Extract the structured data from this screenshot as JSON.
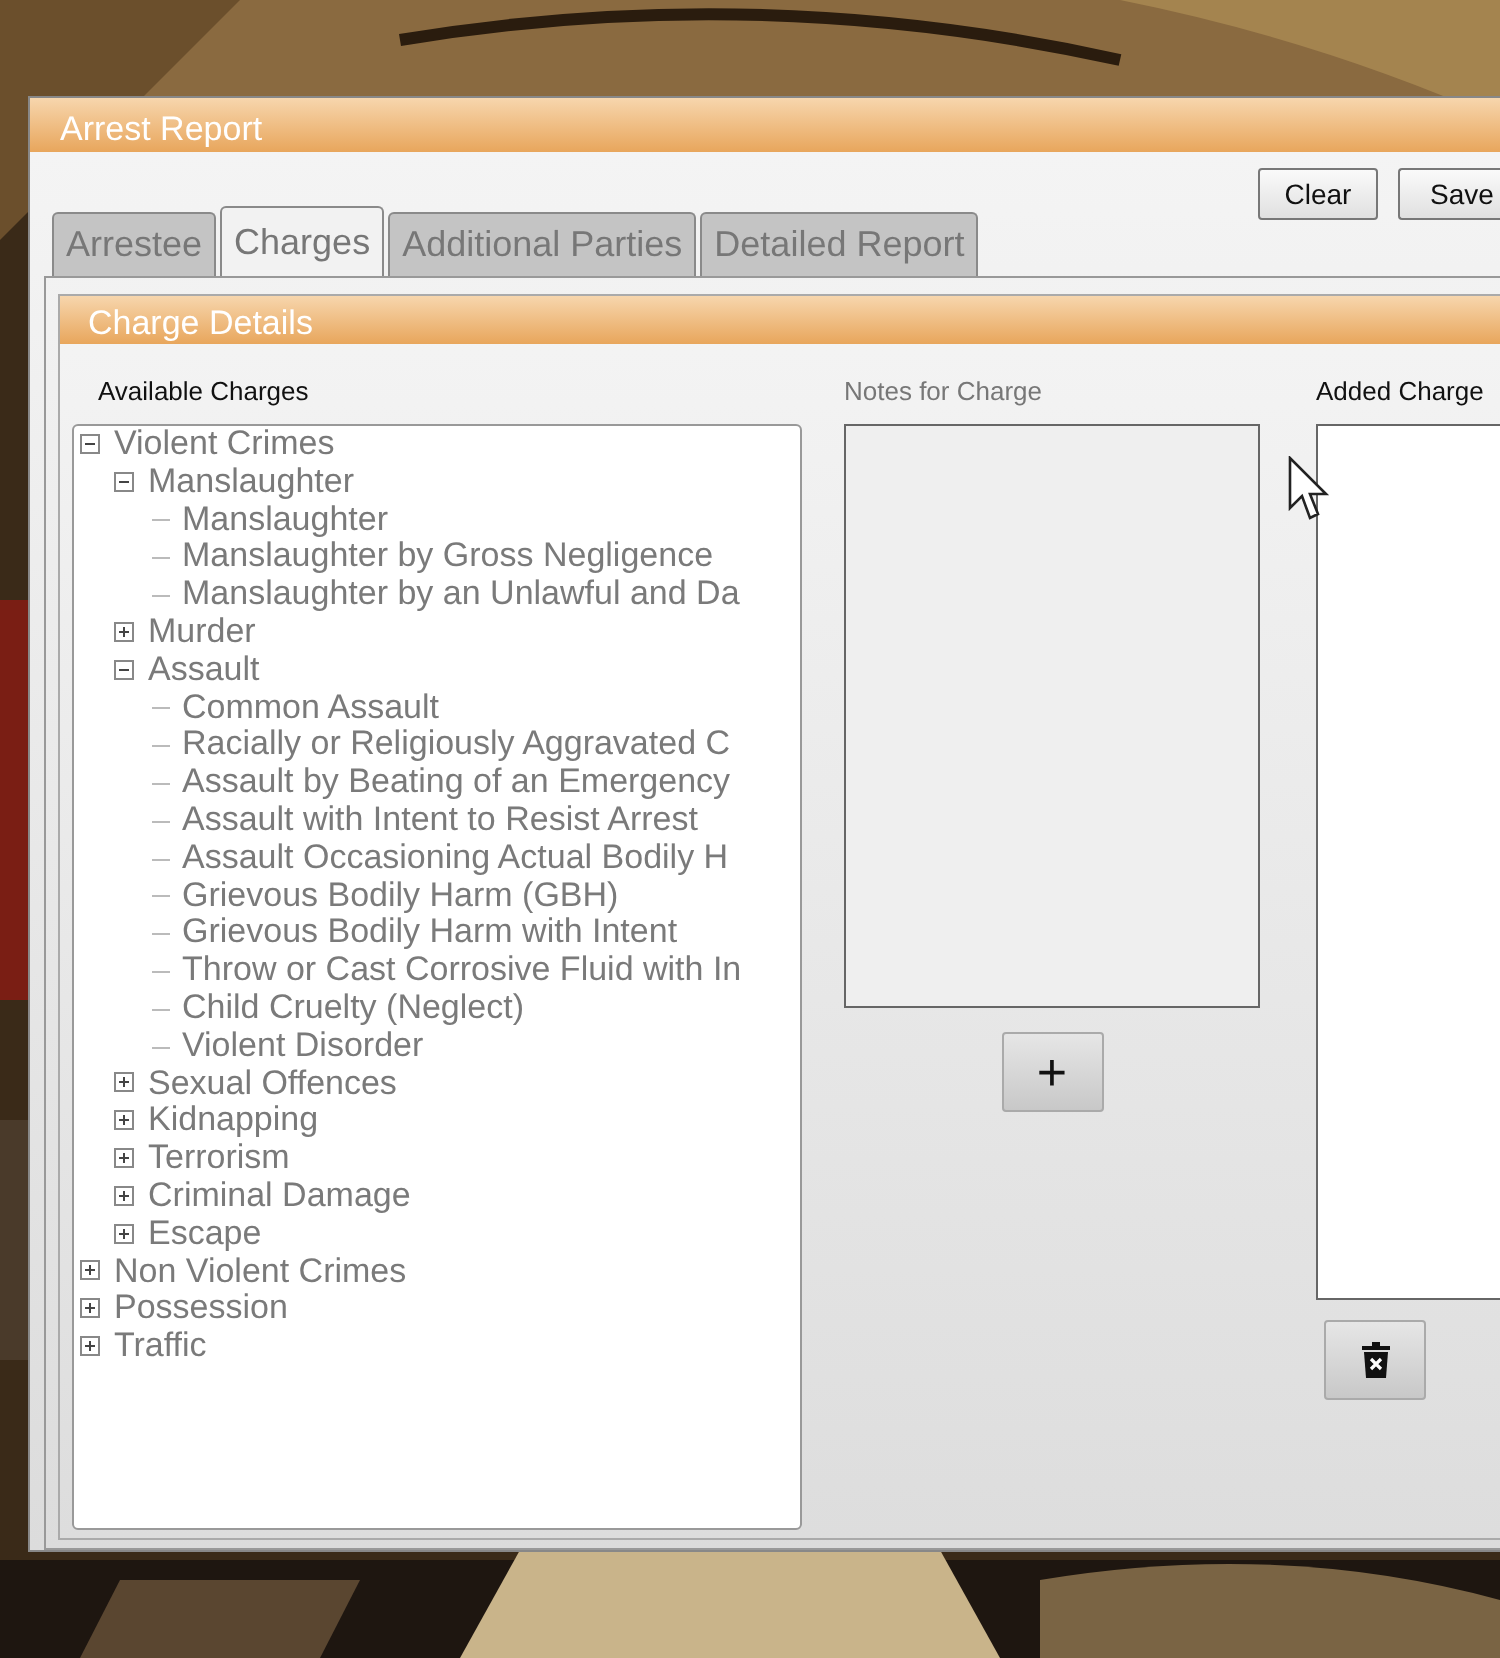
{
  "window": {
    "title": "Arrest Report"
  },
  "buttons": [
    {
      "label": "Clear"
    },
    {
      "label": "Save"
    }
  ],
  "tabs": [
    {
      "label": "Arrestee",
      "selected": false
    },
    {
      "label": "Charges",
      "selected": true
    },
    {
      "label": "Additional Parties",
      "selected": false
    },
    {
      "label": "Detailed Report",
      "selected": false
    }
  ],
  "group": {
    "title": "Charge Details"
  },
  "available_charges": {
    "label": "Available Charges",
    "tree": [
      {
        "label": "Violent Crimes",
        "expanded": true,
        "children": [
          {
            "label": "Manslaughter",
            "expanded": true,
            "children": [
              {
                "label": "Manslaughter"
              },
              {
                "label": "Manslaughter by Gross Negligence"
              },
              {
                "label": "Manslaughter by an Unlawful and Da"
              }
            ]
          },
          {
            "label": "Murder",
            "expanded": false
          },
          {
            "label": "Assault",
            "expanded": true,
            "children": [
              {
                "label": "Common Assault"
              },
              {
                "label": "Racially or Religiously Aggravated C"
              },
              {
                "label": "Assault by Beating of an Emergency"
              },
              {
                "label": "Assault with Intent to Resist Arrest"
              },
              {
                "label": "Assault Occasioning Actual Bodily H"
              },
              {
                "label": "Grievous Bodily Harm (GBH)"
              },
              {
                "label": "Grievous Bodily Harm with Intent"
              },
              {
                "label": "Throw or Cast Corrosive Fluid with In"
              },
              {
                "label": "Child Cruelty (Neglect)"
              },
              {
                "label": "Violent Disorder"
              }
            ]
          },
          {
            "label": "Sexual Offences",
            "expanded": false
          },
          {
            "label": "Kidnapping",
            "expanded": false
          },
          {
            "label": "Terrorism",
            "expanded": false
          },
          {
            "label": "Criminal Damage",
            "expanded": false
          },
          {
            "label": "Escape",
            "expanded": false
          }
        ]
      },
      {
        "label": "Non Violent Crimes",
        "expanded": false
      },
      {
        "label": "Possession",
        "expanded": false
      },
      {
        "label": "Traffic",
        "expanded": false
      }
    ]
  },
  "notes": {
    "label": "Notes for Charge",
    "add_button": {
      "label": "+"
    }
  },
  "added_charges": {
    "label": "Added Charge"
  }
}
